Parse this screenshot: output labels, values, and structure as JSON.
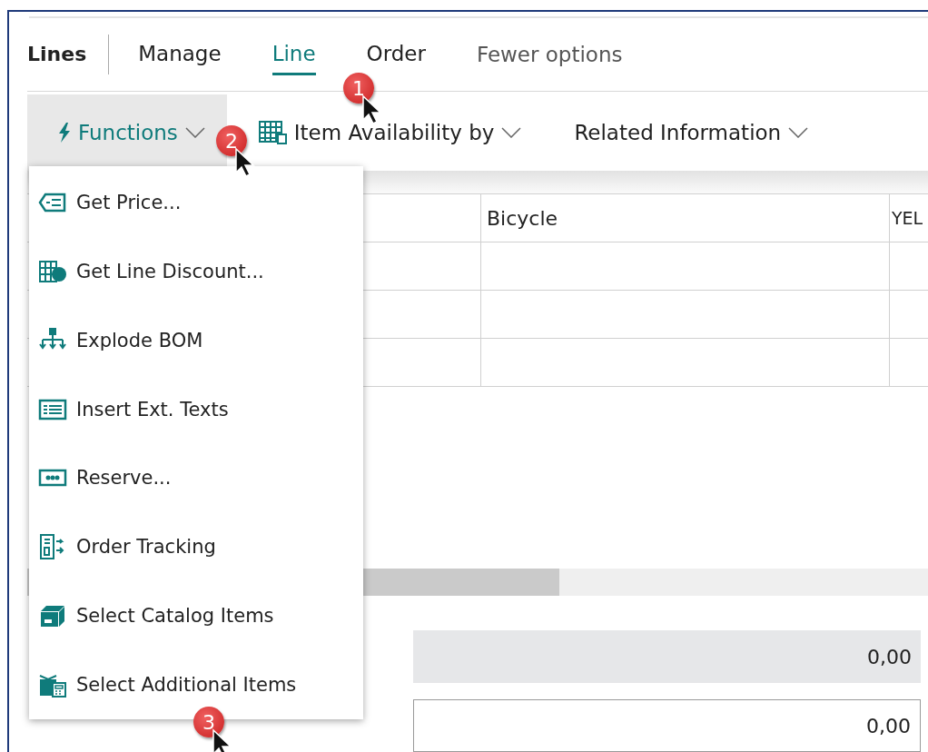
{
  "section_title": "Lines",
  "tabs": [
    {
      "label": "Manage",
      "selected": false
    },
    {
      "label": "Line",
      "selected": true
    },
    {
      "label": "Order",
      "selected": false
    }
  ],
  "fewer_options": "Fewer options",
  "actions": [
    {
      "label": "Functions",
      "kind": "bolt",
      "selected": true
    },
    {
      "label": "Item Availability by",
      "kind": "grid",
      "selected": false
    },
    {
      "label": "Related Information",
      "kind": "plain",
      "selected": false
    }
  ],
  "table": {
    "rows": [
      {
        "column_2": "Bicycle",
        "column_3": "YEL"
      },
      {},
      {},
      {}
    ]
  },
  "totals": [
    {
      "value": "0,00",
      "disabled": true
    },
    {
      "value": "0,00",
      "disabled": false
    }
  ],
  "menu": {
    "items": [
      {
        "label": "Get Price...",
        "kind": "price"
      },
      {
        "label": "Get Line Discount...",
        "kind": "discount"
      },
      {
        "label": "Explode BOM",
        "kind": "tree"
      },
      {
        "label": "Insert Ext. Texts",
        "kind": "text"
      },
      {
        "label": "Reserve...",
        "kind": "reserve"
      },
      {
        "label": "Order Tracking",
        "kind": "tracking"
      },
      {
        "label": "Select Catalog Items",
        "kind": "box"
      },
      {
        "label": "Select Additional Items",
        "kind": "gift"
      }
    ]
  },
  "annotations": [
    {
      "number": "1"
    },
    {
      "number": "2"
    },
    {
      "number": "3"
    }
  ]
}
